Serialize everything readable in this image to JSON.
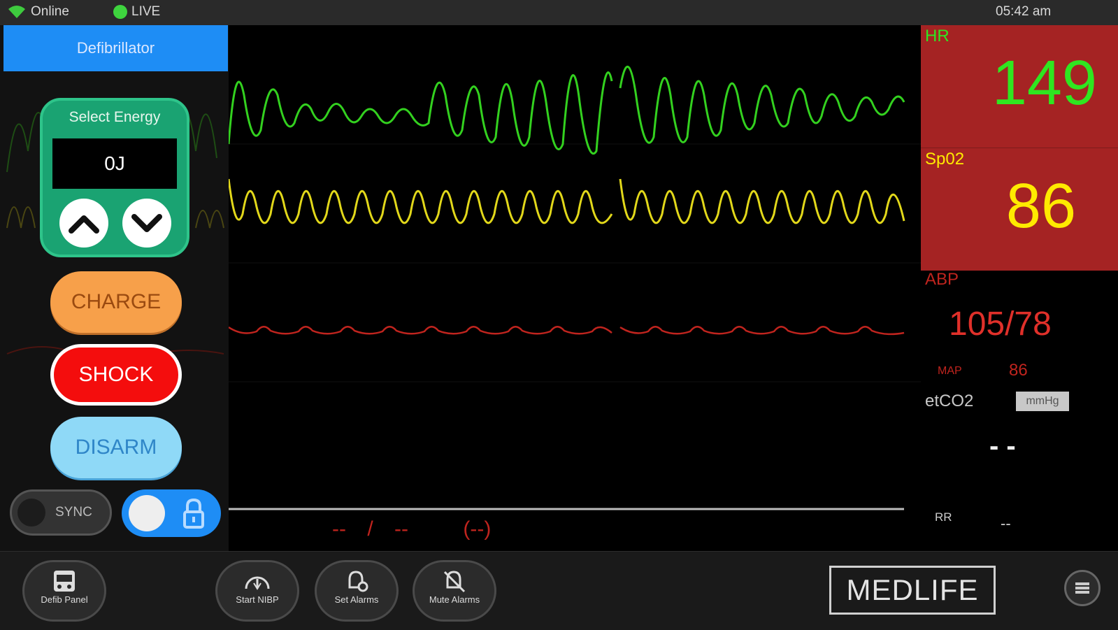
{
  "status": {
    "network": "Online",
    "live": "LIVE",
    "time": "05:42 am"
  },
  "defib": {
    "tab_label": "Defibrillator",
    "energy_title": "Select Energy",
    "energy_value": "0J",
    "charge_label": "CHARGE",
    "shock_label": "SHOCK",
    "disarm_label": "DISARM",
    "sync_label": "SYNC"
  },
  "vitals": {
    "hr_label": "HR",
    "hr_value": "149",
    "spo2_label": "Sp02",
    "spo2_value": "86",
    "abp_label": "ABP",
    "abp_value": "105/78",
    "map_label": "MAP",
    "map_value": "86",
    "etco2_label": "etCO2",
    "etco2_unit": "mmHg",
    "etco2_value": "- -",
    "rr_label": "RR",
    "rr_value": "--"
  },
  "nibp": {
    "systolic": "--",
    "slash": "/",
    "diastolic": "--",
    "mean": "(--)"
  },
  "toolbar": {
    "defib_panel": "Defib Panel",
    "start_nibp": "Start NIBP",
    "set_alarms": "Set Alarms",
    "mute_alarms": "Mute Alarms",
    "logo": "MEDLIFE"
  },
  "colors": {
    "ecg": "#33d11f",
    "pleth": "#e2d81a",
    "abp": "#c0241e",
    "vital_bg": "#a52323",
    "hr_text": "#2fe620",
    "spo2_text": "#ffea00",
    "abp_text": "#e0302a",
    "defib_blue": "#1e8df5",
    "charge": "#f7a04a",
    "shock": "#f40d0d",
    "disarm": "#8fd9f7",
    "energy_green": "#1aa372"
  }
}
